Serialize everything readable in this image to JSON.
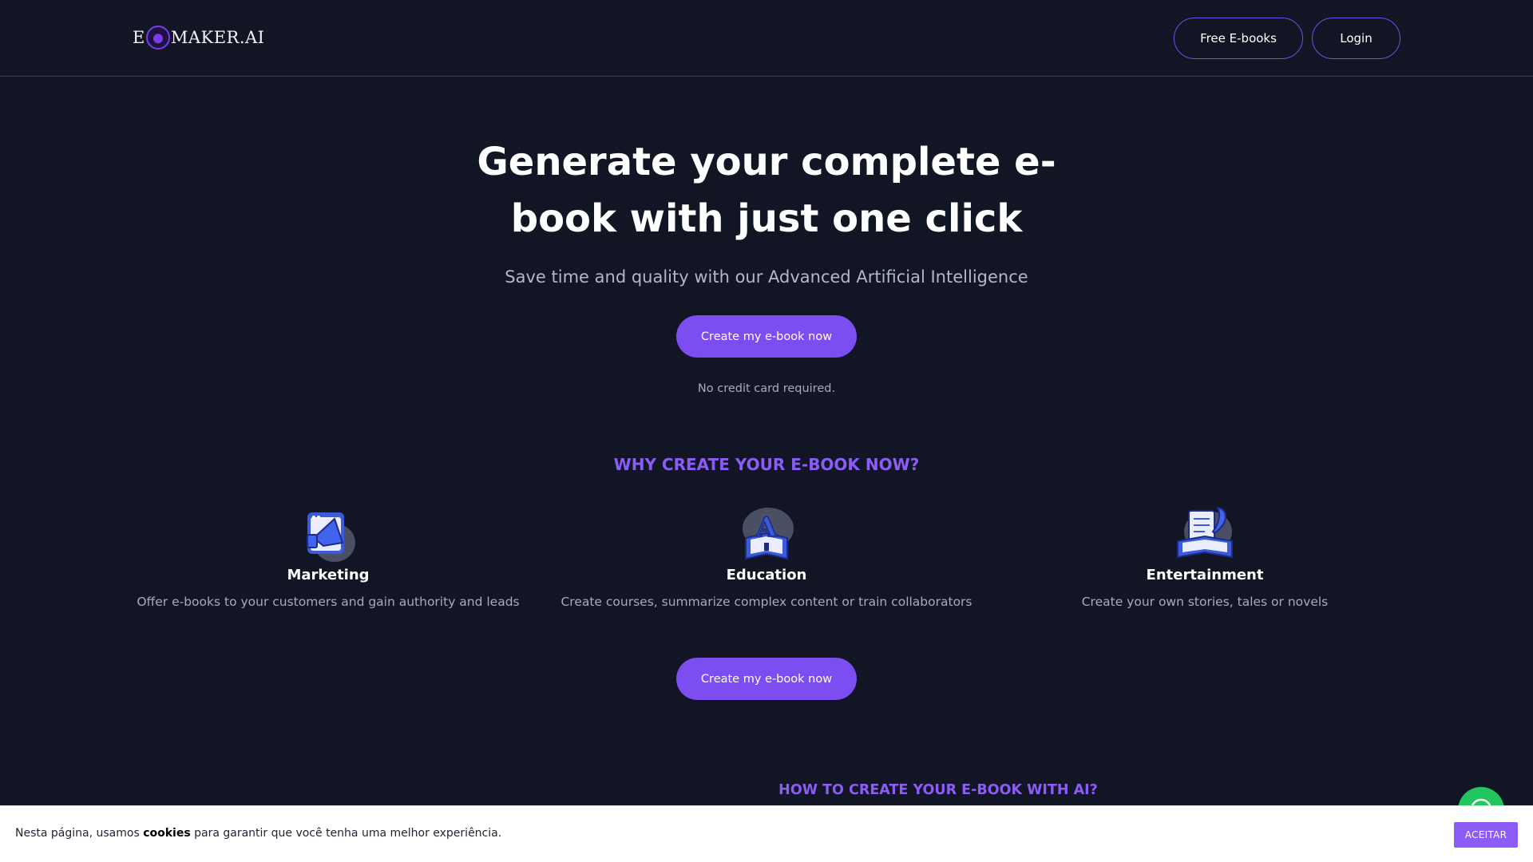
{
  "header": {
    "logo_left": "E",
    "logo_right": "MAKER.AI",
    "nav_free_ebooks": "Free E-books",
    "nav_login": "Login"
  },
  "hero": {
    "title_line1": "Generate your complete e-",
    "title_line2": "book with just one click",
    "subtitle": "Save time and quality with our Advanced Artificial Intelligence",
    "cta": "Create my e-book now",
    "note": "No credit card required."
  },
  "why": {
    "title": "WHY CREATE YOUR E-BOOK NOW?",
    "features": [
      {
        "icon": "megaphone-icon",
        "title": "Marketing",
        "desc": "Offer e-books to your customers and gain authority and leads"
      },
      {
        "icon": "education-book-icon",
        "title": "Education",
        "desc": "Create courses, summarize complex content or train collaborators"
      },
      {
        "icon": "storybook-quill-icon",
        "title": "Entertainment",
        "desc": "Create your own stories, tales or novels"
      }
    ],
    "cta": "Create my e-book now"
  },
  "how": {
    "title": "HOW TO CREATE YOUR E-BOOK WITH AI?"
  },
  "cookie": {
    "text_before": "Nesta página, usamos ",
    "text_bold": "cookies",
    "text_after": " para garantir que você tenha uma melhor experiência.",
    "accept": "ACEITAR"
  },
  "colors": {
    "background": "#121624",
    "accent": "#7c4df0",
    "heading_accent": "#8b5cf6",
    "whatsapp": "#22c55e"
  }
}
